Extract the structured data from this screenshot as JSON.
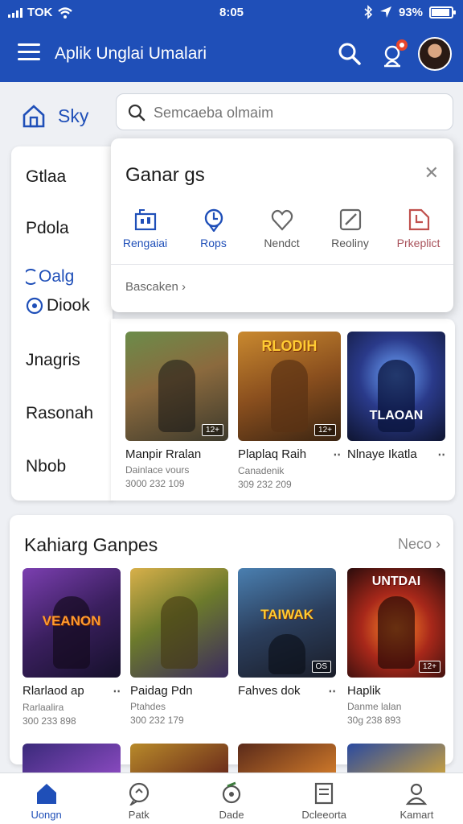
{
  "status_bar": {
    "carrier": "TOK",
    "time": "8:05",
    "battery": "93%",
    "battery_level": 0.93
  },
  "app_bar": {
    "title": "Aplik Unglai Umalari"
  },
  "nav": {
    "home_label": "Sky"
  },
  "search": {
    "placeholder": "Semcaeba olmaim"
  },
  "side_menu": {
    "items": [
      "Gtlaa",
      "Pdola",
      "Oalg",
      "Diook",
      "Jnagris",
      "Rasonah",
      "Nbob"
    ]
  },
  "popup": {
    "title": "Ganar gs",
    "categories": [
      "Rengaiai",
      "Rops",
      "Nendct",
      "Reoliny",
      "Prkeplict"
    ],
    "more_label": "Bascaken"
  },
  "featured_games": [
    {
      "title": "Manpir Rralan",
      "subtitle": "Dainlace vours",
      "meta": "3000 232 109",
      "badge": "",
      "logo": ""
    },
    {
      "title": "Plaplaq Raih",
      "subtitle": "Canadenik",
      "meta": "309 232 209",
      "badge": "",
      "logo": "RLODIH"
    },
    {
      "title": "Nlnaye Ikatla",
      "subtitle": "",
      "meta": "",
      "badge": "",
      "logo": "TLAOAN"
    }
  ],
  "section2": {
    "title": "Kahiarg Ganpes",
    "see_all": "Neco",
    "games": [
      {
        "title": "Rlarlaod ap",
        "subtitle": "Rarlaalira",
        "meta": "300 233 898",
        "logo": "VEANON",
        "badge": ""
      },
      {
        "title": "Paidag Pdn",
        "subtitle": "Ptahdes",
        "meta": "300 232 179",
        "logo": "",
        "badge": ""
      },
      {
        "title": "Fahves dok",
        "subtitle": "",
        "meta": "",
        "logo": "TAIWAK",
        "badge": "OS"
      },
      {
        "title": "Haplik",
        "subtitle": "Danme lalan",
        "meta": "30g 238 893",
        "logo": "UNTDAI",
        "badge": ""
      }
    ]
  },
  "tab_bar": {
    "items": [
      {
        "label": "Uongn",
        "icon": "home-icon",
        "active": true
      },
      {
        "label": "Patk",
        "icon": "chat-icon",
        "active": false
      },
      {
        "label": "Dade",
        "icon": "sync-icon",
        "active": false
      },
      {
        "label": "Dcleeorta",
        "icon": "document-icon",
        "active": false
      },
      {
        "label": "Kamart",
        "icon": "profile-icon",
        "active": false
      }
    ]
  },
  "colors": {
    "primary": "#1f4fb8",
    "accent": "#e8452c"
  }
}
